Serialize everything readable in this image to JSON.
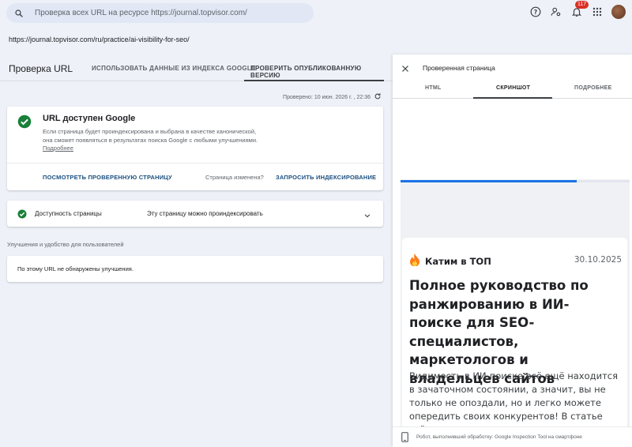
{
  "search": {
    "placeholder": "Проверка всех URL на ресурсе https://journal.topvisor.com/"
  },
  "top_icons": {
    "notifications_count": "117"
  },
  "inspected_url": "https://journal.topvisor.com/ru/practice/ai-visibility-for-seo/",
  "left": {
    "title": "Проверка URL",
    "tabs": [
      {
        "label": "ИСПОЛЬЗОВАТЬ ДАННЫЕ ИЗ ИНДЕКСА GOOGLE",
        "active": false
      },
      {
        "label": "ПРОВЕРИТЬ ОПУБЛИКОВАННУЮ ВЕРСИЮ",
        "active": true
      }
    ],
    "checked_at": "Проверено: 10 июн. 2026 г. , 22:36",
    "status_card": {
      "heading": "URL доступен Google",
      "line1": "Если страница будет проиндексирована и выбрана в качестве канонической,",
      "line2": "она сможет появляться в результатах поиска Google с любыми улучшениями.",
      "more_link": "Подробнее",
      "view_button": "ПОСМОТРЕТЬ ПРОВЕРЕННУЮ СТРАНИЦУ",
      "changed_text": "Страница изменена?",
      "request_button": "ЗАПРОСИТЬ ИНДЕКСИРОВАНИЕ"
    },
    "availability": {
      "label": "Доступность страницы",
      "value": "Эту страницу можно проиндексировать"
    },
    "enhancements": {
      "section_title": "Улучшения и удобство для пользователей",
      "text": "По этому URL не обнаружены улучшения."
    }
  },
  "right": {
    "title": "Проверенная страница",
    "tabs": [
      {
        "label": "HTML",
        "active": false
      },
      {
        "label": "СКРИНШОТ",
        "active": true
      },
      {
        "label": "ПОДРОБНЕЕ",
        "active": false
      }
    ],
    "screenshot": {
      "load_progress": 0.77,
      "category": "Катим в ТОП",
      "date": "30.10.2025",
      "title": "Полное руководство по ранжированию в ИИ-поиске для SEO-специалистов, маркетологов и владельцев сайтов",
      "lead": "Видимость в ИИ-поиске всё ещё находится в зачаточном состоянии, а значит, вы не только не опоздали, но и легко можете опередить своих конкурентов! В статье всё о том, как это делать."
    },
    "footer": "Робот, выполнивший обработку: Google Inspection Tool на смартфоне"
  },
  "colors": {
    "accent": "#1a73e8",
    "success": "#188038",
    "link": "#1a4f80",
    "badge": "#d93025"
  }
}
